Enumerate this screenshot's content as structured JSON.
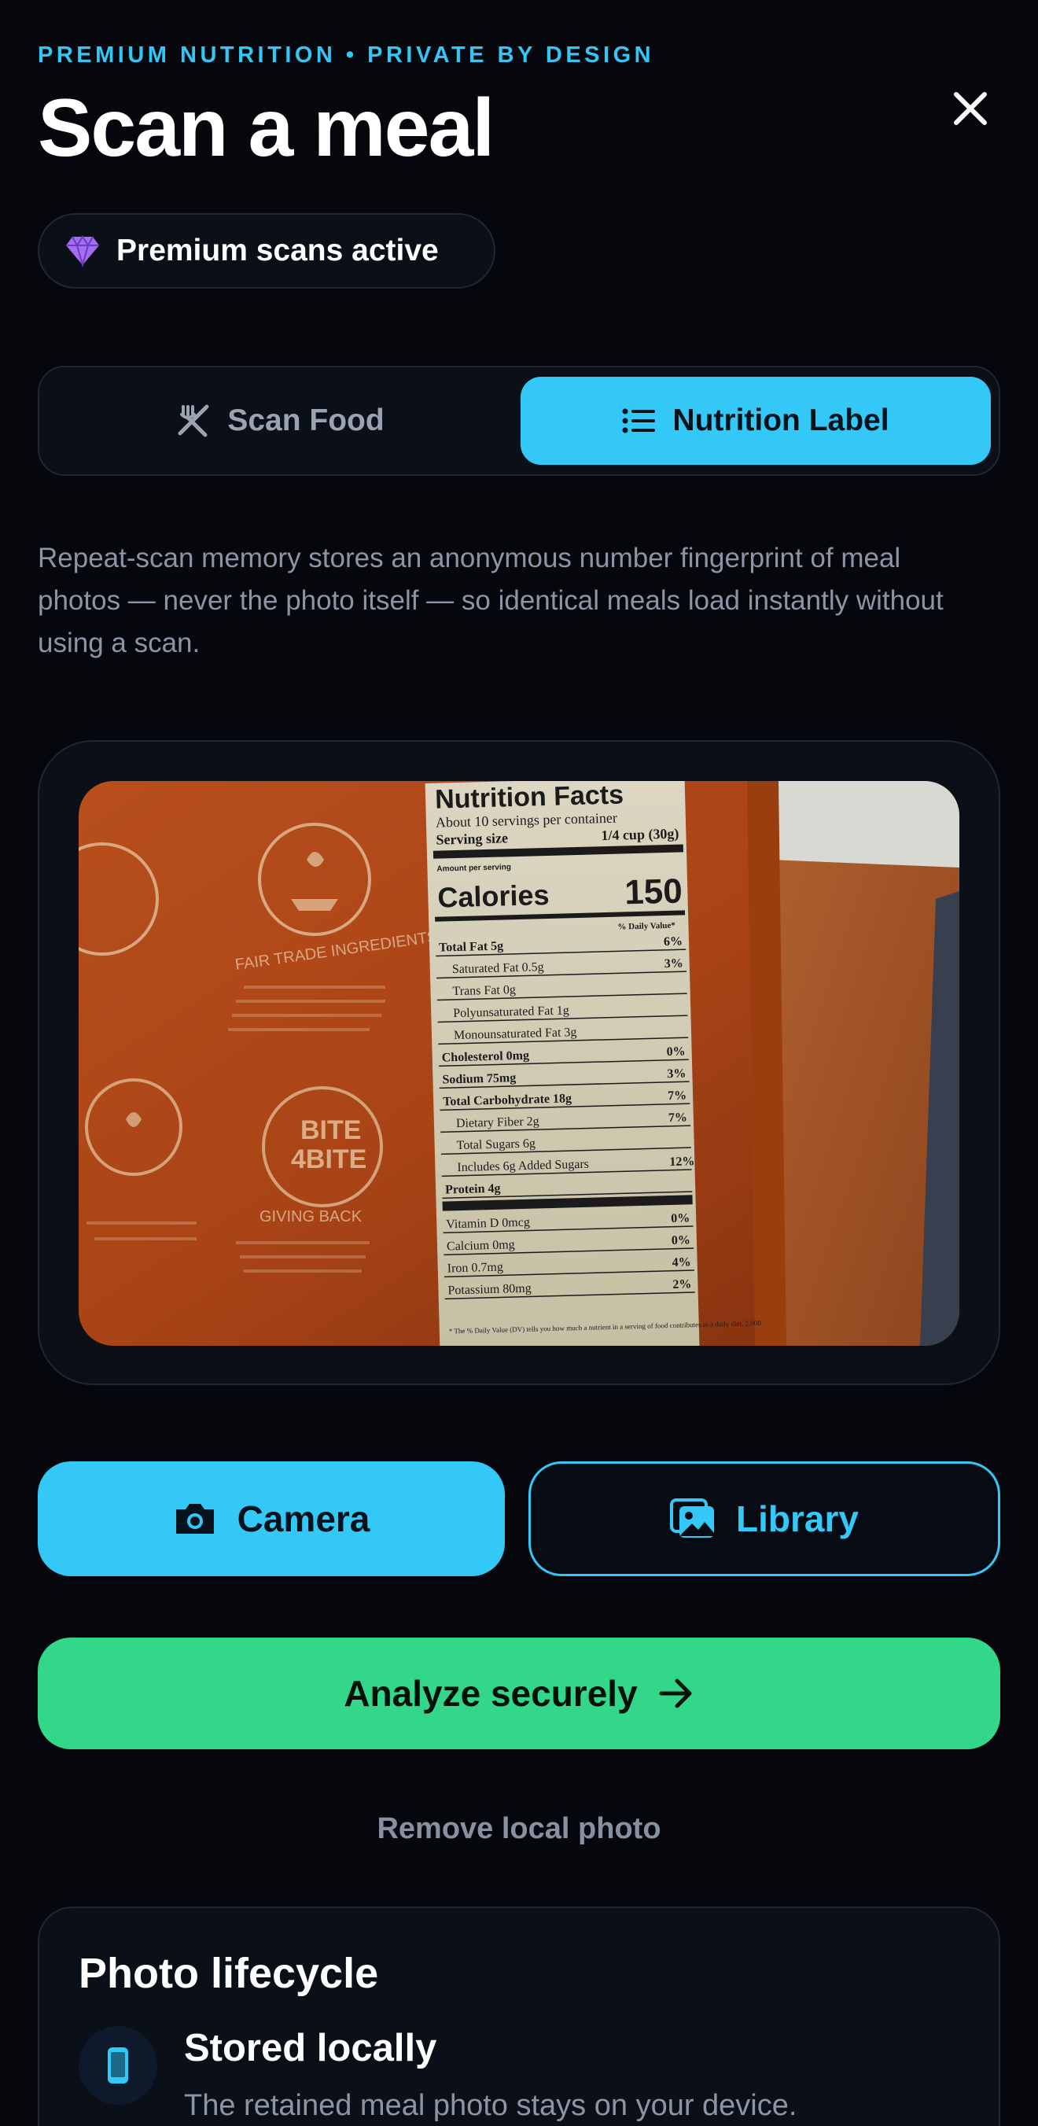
{
  "header": {
    "kicker": "PREMIUM NUTRITION • PRIVATE BY DESIGN",
    "title": "Scan a meal",
    "close_icon": "close-icon"
  },
  "premium_badge": {
    "icon": "diamond-icon",
    "label": "Premium scans active",
    "icon_color": "#a66cf2"
  },
  "mode_tabs": [
    {
      "label": "Scan Food",
      "icon": "fork-knife-icon",
      "selected": false
    },
    {
      "label": "Nutrition Label",
      "icon": "list-icon",
      "selected": true
    }
  ],
  "description": "Repeat-scan memory stores an anonymous number fingerprint of meal photos — never the photo itself — so identical meals load instantly without using a scan.",
  "photo_preview": {
    "label": {
      "heading": "Nutrition Facts",
      "servings": "About 10 servings per container",
      "serving_size_label": "Serving size",
      "serving_size_value": "1/4 cup (30g)",
      "amount_per_serving": "Amount per serving",
      "calories_label": "Calories",
      "calories_value": "150",
      "daily_value_header": "% Daily Value*",
      "rows": [
        {
          "text": "Total Fat 5g",
          "dv": "6%"
        },
        {
          "text": "Saturated Fat 0.5g",
          "dv": "3%"
        },
        {
          "text": "Trans Fat 0g",
          "dv": ""
        },
        {
          "text": "Polyunsaturated Fat 1g",
          "dv": ""
        },
        {
          "text": "Monounsaturated Fat 3g",
          "dv": ""
        },
        {
          "text": "Cholesterol 0mg",
          "dv": "0%"
        },
        {
          "text": "Sodium 75mg",
          "dv": "3%"
        },
        {
          "text": "Total Carbohydrate 18g",
          "dv": "7%"
        },
        {
          "text": "Dietary Fiber 2g",
          "dv": "7%"
        },
        {
          "text": "Total Sugars 6g",
          "dv": ""
        },
        {
          "text": "Includes 6g Added Sugars",
          "dv": "12%"
        },
        {
          "text": "Protein 4g",
          "dv": ""
        },
        {
          "text": "Vitamin D 0mcg",
          "dv": "0%"
        },
        {
          "text": "Calcium 0mg",
          "dv": "0%"
        },
        {
          "text": "Iron 0.7mg",
          "dv": "4%"
        },
        {
          "text": "Potassium 80mg",
          "dv": "2%"
        }
      ],
      "footnote": "* The % Daily Value (DV) tells you how much a nutrient in a serving of food contributes to a daily diet. 2,000"
    },
    "package": {
      "text_1": "FAIR TRADE INGREDIENTS",
      "logo_line_1": "BITE",
      "logo_line_2": "4BITE",
      "text_2": "GIVING BACK"
    }
  },
  "actions": {
    "camera": {
      "label": "Camera",
      "icon": "camera-icon"
    },
    "library": {
      "label": "Library",
      "icon": "photo-library-icon"
    },
    "analyze": {
      "label": "Analyze securely",
      "icon": "arrow-right-icon"
    },
    "remove": "Remove local photo"
  },
  "lifecycle": {
    "title": "Photo lifecycle",
    "steps": [
      {
        "icon": "phone-icon",
        "title": "Stored locally",
        "text": "The retained meal photo stays on your device."
      }
    ]
  },
  "colors": {
    "accent": "#33c8f6",
    "success": "#33d78a",
    "background": "#05070c",
    "card": "#0a0f18"
  }
}
